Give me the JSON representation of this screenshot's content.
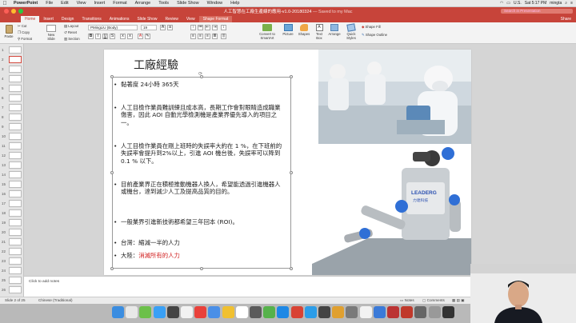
{
  "menubar": {
    "app": "PowerPoint",
    "items": [
      "File",
      "Edit",
      "View",
      "Insert",
      "Format",
      "Arrange",
      "Tools",
      "Slide Show",
      "Window",
      "Help"
    ],
    "right": {
      "input": "U.S.",
      "clock": "Sat 5:17 PM",
      "user": "mingta"
    }
  },
  "window": {
    "title": "人工智慧在工廠生產線的應用-v1.0-20180324",
    "saved": "— Saved to my Mac",
    "search_placeholder": "Search in Presentation"
  },
  "tabs": [
    "Home",
    "Insert",
    "Design",
    "Transitions",
    "Animations",
    "Slide Show",
    "Review",
    "View",
    "Shape Format"
  ],
  "active_tab": "Home",
  "share": "Share",
  "ribbon": {
    "paste": "Paste",
    "cut": "Cut",
    "copy": "Copy",
    "format": "Format",
    "new_slide": "New Slide",
    "layout": "Layout",
    "reset": "Reset",
    "section": "Section",
    "font_name": "PMingLiU (Body)",
    "font_size": "19",
    "convert_smartart": "Convert to SmartArt",
    "picture": "Picture",
    "shapes": "Shapes",
    "text_box": "Text Box",
    "arrange": "Arrange",
    "quick_styles": "Quick Styles",
    "shape_fill": "Shape Fill",
    "shape_outline": "Shape Outline"
  },
  "thumbnails": [
    "1",
    "2",
    "3",
    "4",
    "5",
    "6",
    "7",
    "8",
    "9",
    "10",
    "11",
    "12",
    "13",
    "14",
    "15",
    "16",
    "17",
    "18",
    "19",
    "20",
    "21",
    "22",
    "23",
    "24",
    "25",
    "26"
  ],
  "selected_slide": "2",
  "slide": {
    "title": "工廠經驗",
    "bullets": [
      {
        "dot": "•",
        "text": "黏著度 24小時 365天"
      },
      {
        "dot": "•",
        "text": "人工目檢作業員難訓練且成本高，長期工作會對眼睛造成職業傷害，因此 AOI 自動光學檢測機是產業界優先導入的項目之一。"
      },
      {
        "dot": "•",
        "text": "人工目檢作業員在剛上班時的失誤率大約在 1 %，在下班前的失誤率會提升到2%以上，引進 AOI 機台後，失誤率可以降到 0.1 % 以下。"
      },
      {
        "dot": "•",
        "text": "目前產業界正在積極推動機器人換人，希望能透過引進機器人或機台，達到減少人工及提高品質的目的。"
      },
      {
        "dot": "•",
        "text": "一般業界引進新技術都希望三年回本 (ROI)。"
      },
      {
        "dot": "•",
        "text": "台灣：縮減一半的人力"
      },
      {
        "dot": "•",
        "prefix": "大陸：",
        "text": "消滅所有的人力"
      }
    ],
    "robot_brand": "LEADERG",
    "robot_brand_sub": "力達科技"
  },
  "notes_placeholder": "Click to add notes",
  "status": {
    "slide_pos": "Slide 2 of 25",
    "language": "Chinese (Traditional)",
    "notes": "Notes",
    "comments": "Comments",
    "zoom": "80%"
  },
  "colors": {
    "accent": "#c7443a",
    "red_text": "#d11f1f"
  }
}
